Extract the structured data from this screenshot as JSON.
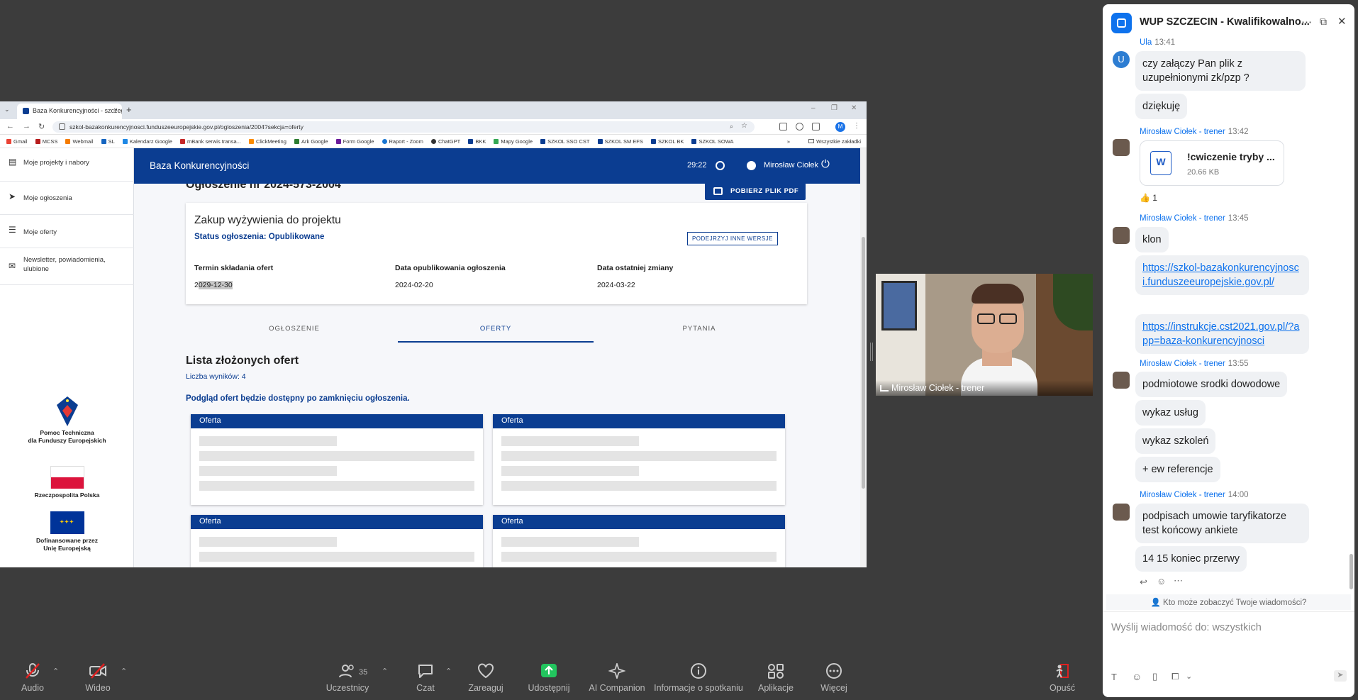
{
  "browser": {
    "tab_title": "Baza Konkurencyjności - szczeg",
    "url": "szkol-bazakonkurencyjnosci.funduszeeuropejskie.gov.pl/ogloszenia/2004?sekcja=oferty",
    "profile_initial": "M",
    "bookmarks": [
      "Gmail",
      "MCSS",
      "Webmail",
      "SL",
      "Kalendarz Google",
      "mBank serwis transa...",
      "ClickMeeting",
      "Ark Google",
      "Form Google",
      "Raport - Zoom",
      "ChatGPT",
      "BKK",
      "Mapy Google",
      "SZKOL SSO CST",
      "SZKOL SM EFS",
      "SZKOL BK",
      "SZKOL SOWA"
    ],
    "bookmarks_more": "»",
    "all_bookmarks": "Wszystkie zakładki"
  },
  "site": {
    "app_title": "Baza Konkurencyjności",
    "timer": "29:22",
    "user_name": "Mirosław Ciołek",
    "sidebar": [
      {
        "label": "Moje projekty i nabory",
        "icon": "projects-icon"
      },
      {
        "label": "Moje ogłoszenia",
        "icon": "send-icon"
      },
      {
        "label": "Moje oferty",
        "icon": "list-icon"
      },
      {
        "label": "Newsletter, powiadomienia, ulubione",
        "icon": "mail-icon"
      }
    ],
    "logos": {
      "pt": "Pomoc Techniczna\ndla Funduszy Europejskich",
      "rp": "Rzeczpospolita Polska",
      "ue": "Dofinansowane przez\nUnię Europejską"
    },
    "page_title": "Ogłoszenie nr 2024-573-2004",
    "pdf_button": "POBIERZ PLIK PDF",
    "notice_title": "Zakup wyżywienia do projektu",
    "status": "Status ogłoszenia: Opublikowane",
    "versions_button": "PODEJRZYJ INNE WERSJE",
    "meta": [
      {
        "label": "Termin składania ofert",
        "value_prefix": "2",
        "value_highlight": "029-12-30"
      },
      {
        "label": "Data opublikowania ogłoszenia",
        "value": "2024-02-20"
      },
      {
        "label": "Data ostatniej zmiany",
        "value": "2024-03-22"
      }
    ],
    "tabs": [
      "OGŁOSZENIE",
      "OFERTY",
      "PYTANIA"
    ],
    "active_tab": "OFERTY",
    "list_title": "Lista złożonych ofert",
    "result_count": "Liczba wyników: 4",
    "preview_notice": "Podgląd ofert będzie dostępny po zamknięciu ogłoszenia.",
    "offer_label": "Oferta"
  },
  "video": {
    "participant": "Mirosław Ciołek - trener"
  },
  "chat": {
    "title": "WUP SZCZECIN - Kwalifikowalno...",
    "messages": {
      "ula_meta_name": "Ula",
      "ula_meta_time": "13:41",
      "ula_avatar": "U",
      "ula_1": "czy załączy Pan plik z uzupełnionymi zk/pzp ?",
      "ula_2": "dziękuję",
      "t1_name": "Mirosław Ciołek - trener",
      "t1_time": "13:42",
      "file_name": "!cwiczenie tryby ...",
      "file_size": "20.66 KB",
      "reaction": "👍 1",
      "t2_time": "13:45",
      "klon": "klon",
      "link1": "https://szkol-bazakonkurencyjnosci.funduszeeuropejskie.gov.pl/",
      "link2": "https://instrukcje.cst2021.gov.pl/?app=baza-konkurencyjnosci",
      "t3_time": "13:55",
      "m3a": "podmiotowe srodki dowodowe",
      "m3b": "wykaz usług",
      "m3c": "wykaz szkoleń",
      "m3d": "+ ew referencje",
      "t4_time": "14:00",
      "m4a": "podpisach umowie taryfikatorze test końcowy ankiete",
      "m4b": "14 15 koniec przerwy"
    },
    "visibility": "Kto może zobaczyć Twoje wiadomości?",
    "compose_placeholder": "Wyślij wiadomość do: wszystkich"
  },
  "toolbar": {
    "audio": "Audio",
    "video": "Wideo",
    "participants": "Uczestnicy",
    "participants_count": "35",
    "chat": "Czat",
    "react": "Zareaguj",
    "share": "Udostępnij",
    "ai": "AI Companion",
    "info": "Informacje o spotkaniu",
    "apps": "Aplikacje",
    "more": "Więcej",
    "leave": "Opuść"
  },
  "colors": {
    "site_blue": "#0b3d91",
    "zoom_blue": "#0e72ed",
    "share_green": "#22c55e"
  }
}
